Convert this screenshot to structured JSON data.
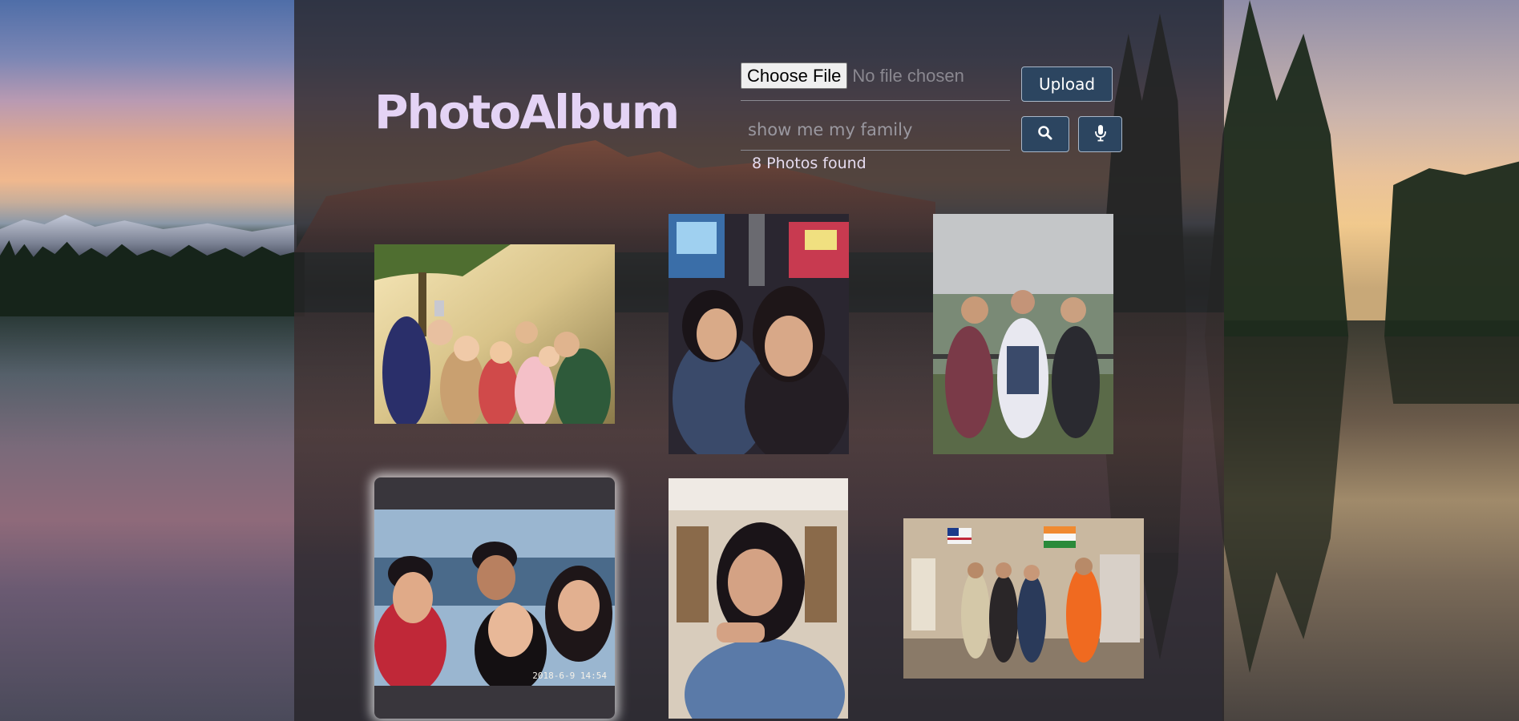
{
  "app": {
    "title": "PhotoAlbum"
  },
  "upload": {
    "choose_label": "Choose File",
    "file_status": "No file chosen",
    "upload_label": "Upload"
  },
  "search": {
    "query": "show me my family",
    "results_text": "8 Photos found"
  },
  "icons": {
    "search": "search-icon",
    "mic": "microphone-icon"
  },
  "colors": {
    "logo": "#e4d3f5",
    "button_bg": "#2c4560",
    "button_border": "#a9b7c8"
  },
  "photos": [
    {
      "name": "family-selfie-park"
    },
    {
      "name": "two-women-selfie-city-night"
    },
    {
      "name": "three-people-lookout"
    },
    {
      "name": "four-people-selfie-harbor",
      "stamp": "2018-6-9 14:54"
    },
    {
      "name": "woman-portrait-cafe"
    },
    {
      "name": "group-space-museum"
    }
  ]
}
